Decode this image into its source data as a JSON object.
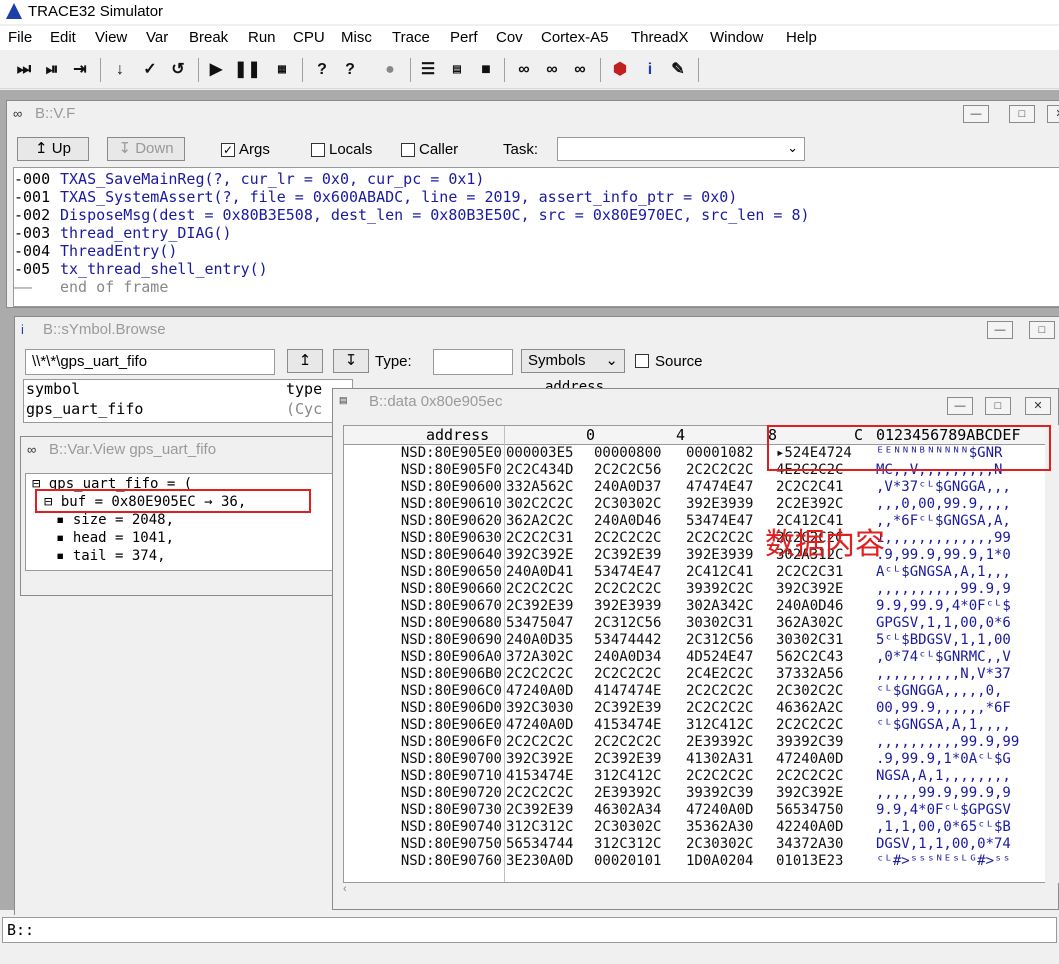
{
  "app": {
    "title": "TRACE32 Simulator"
  },
  "menu": [
    "File",
    "Edit",
    "View",
    "Var",
    "Break",
    "Run",
    "CPU",
    "Misc",
    "Trace",
    "Perf",
    "Cov",
    "Cortex-A5",
    "ThreadX",
    "Window",
    "Help"
  ],
  "frame_window": {
    "title": "B::V.F",
    "up_label": "Up",
    "down_label": "Down",
    "args_label": "Args",
    "locals_label": "Locals",
    "caller_label": "Caller",
    "task_label": "Task:",
    "task_value": "",
    "frames": [
      {
        "level": "-000",
        "text": "TXAS_SaveMainReg(?, cur_lr = 0x0, cur_pc = 0x1)"
      },
      {
        "level": "-001",
        "text": "TXAS_SystemAssert(?, file = 0x600ABADC, line = 2019, assert_info_ptr = 0x0)"
      },
      {
        "level": "-002",
        "text": "DisposeMsg(dest = 0x80B3E508, dest_len = 0x80B3E50C, src = 0x80E970EC, src_len = 8)"
      },
      {
        "level": "-003",
        "text": "thread_entry_DIAG()"
      },
      {
        "level": "-004",
        "text": "ThreadEntry()"
      },
      {
        "level": "-005",
        "text": "tx_thread_shell_entry()"
      },
      {
        "level": "——",
        "text": "end of frame"
      }
    ]
  },
  "symbol_window": {
    "title": "B::sYmbol.Browse",
    "filter": "\\\\*\\*\\gps_uart_fifo",
    "type_label": "Type:",
    "type_value": "",
    "mode_value": "Symbols",
    "source_label": "Source",
    "col_symbol": "symbol",
    "col_type": "type",
    "col_address": "address",
    "row_symbol": "gps_uart_fifo",
    "row_type": "(Cyc"
  },
  "var_window": {
    "title": "B::Var.View gps_uart_fifo",
    "lines": [
      "gps_uart_fifo = (",
      "buf = 0x80E905EC → 36,",
      "size = 2048,",
      "head = 1041,",
      "tail = 374,"
    ]
  },
  "data_window": {
    "title": "B::data 0x80e905ec",
    "col_address": "address",
    "col_0": "0",
    "col_4": "4",
    "col_8": "8",
    "col_c": "C",
    "col_ascii": "0123456789ABCDEF",
    "annotation": "数据内容",
    "rows": [
      {
        "a": "NSD:80E905E0",
        "w": [
          "000003E5",
          "00000800",
          "00001082",
          "▸524E4724"
        ],
        "s": "ᴱᴱᴺᴺᴺᴮᴺᴺᴺᴺᴺ$GNR"
      },
      {
        "a": "NSD:80E905F0",
        "w": [
          "2C2C434D",
          "2C2C2C56",
          "2C2C2C2C",
          "4E2C2C2C"
        ],
        "s": "MC,,V,,,,,,,,,N"
      },
      {
        "a": "NSD:80E90600",
        "w": [
          "332A562C",
          "240A0D37",
          "47474E47",
          "2C2C2C41"
        ],
        "s": ",V*37ᶜᴸ$GNGGA,,,"
      },
      {
        "a": "NSD:80E90610",
        "w": [
          "302C2C2C",
          "2C30302C",
          "392E3939",
          "2C2E392C"
        ],
        "s": ",,,0,00,99.9,,,,"
      },
      {
        "a": "NSD:80E90620",
        "w": [
          "362A2C2C",
          "240A0D46",
          "53474E47",
          "2C412C41"
        ],
        "s": ",,*6Fᶜᴸ$GNGSA,A,"
      },
      {
        "a": "NSD:80E90630",
        "w": [
          "2C2C2C31",
          "2C2C2C2C",
          "2C2C2C2C",
          "2C2C2C2C"
        ],
        "s": "1,,,,,,,,,,,,,99"
      },
      {
        "a": "NSD:80E90640",
        "w": [
          "392C392E",
          "2C392E39",
          "392E3939",
          "302A312C"
        ],
        "s": ".9,99.9,99.9,1*0"
      },
      {
        "a": "NSD:80E90650",
        "w": [
          "240A0D41",
          "53474E47",
          "2C412C41",
          "2C2C2C31"
        ],
        "s": "Aᶜᴸ$GNGSA,A,1,,,"
      },
      {
        "a": "NSD:80E90660",
        "w": [
          "2C2C2C2C",
          "2C2C2C2C",
          "39392C2C",
          "392C392E"
        ],
        "s": ",,,,,,,,,,99.9,9"
      },
      {
        "a": "NSD:80E90670",
        "w": [
          "2C392E39",
          "392E3939",
          "302A342C",
          "240A0D46"
        ],
        "s": "9.9,99.9,4*0Fᶜᴸ$"
      },
      {
        "a": "NSD:80E90680",
        "w": [
          "53475047",
          "2C312C56",
          "30302C31",
          "362A302C"
        ],
        "s": "GPGSV,1,1,00,0*6"
      },
      {
        "a": "NSD:80E90690",
        "w": [
          "240A0D35",
          "53474442",
          "2C312C56",
          "30302C31"
        ],
        "s": "5ᶜᴸ$BDGSV,1,1,00"
      },
      {
        "a": "NSD:80E906A0",
        "w": [
          "372A302C",
          "240A0D34",
          "4D524E47",
          "562C2C43"
        ],
        "s": ",0*74ᶜᴸ$GNRMC,,V"
      },
      {
        "a": "NSD:80E906B0",
        "w": [
          "2C2C2C2C",
          "2C2C2C2C",
          "2C4E2C2C",
          "37332A56"
        ],
        "s": ",,,,,,,,,,N,V*37"
      },
      {
        "a": "NSD:80E906C0",
        "w": [
          "47240A0D",
          "4147474E",
          "2C2C2C2C",
          "2C302C2C"
        ],
        "s": "ᶜᴸ$GNGGA,,,,,0,"
      },
      {
        "a": "NSD:80E906D0",
        "w": [
          "392C3030",
          "2C392E39",
          "2C2C2C2C",
          "46362A2C"
        ],
        "s": "00,99.9,,,,,,*6F"
      },
      {
        "a": "NSD:80E906E0",
        "w": [
          "47240A0D",
          "4153474E",
          "312C412C",
          "2C2C2C2C"
        ],
        "s": "ᶜᴸ$GNGSA,A,1,,,,"
      },
      {
        "a": "NSD:80E906F0",
        "w": [
          "2C2C2C2C",
          "2C2C2C2C",
          "2E39392C",
          "39392C39"
        ],
        "s": ",,,,,,,,,,99.9,99"
      },
      {
        "a": "NSD:80E90700",
        "w": [
          "392C392E",
          "2C392E39",
          "41302A31",
          "47240A0D"
        ],
        "s": ".9,99.9,1*0Aᶜᴸ$G"
      },
      {
        "a": "NSD:80E90710",
        "w": [
          "4153474E",
          "312C412C",
          "2C2C2C2C",
          "2C2C2C2C"
        ],
        "s": "NGSA,A,1,,,,,,,,"
      },
      {
        "a": "NSD:80E90720",
        "w": [
          "2C2C2C2C",
          "2E39392C",
          "39392C39",
          "392C392E"
        ],
        "s": ",,,,,99.9,99.9,9"
      },
      {
        "a": "NSD:80E90730",
        "w": [
          "2C392E39",
          "46302A34",
          "47240A0D",
          "56534750"
        ],
        "s": "9.9,4*0Fᶜᴸ$GPGSV"
      },
      {
        "a": "NSD:80E90740",
        "w": [
          "312C312C",
          "2C30302C",
          "35362A30",
          "42240A0D"
        ],
        "s": ",1,1,00,0*65ᶜᴸ$B"
      },
      {
        "a": "NSD:80E90750",
        "w": [
          "56534744",
          "312C312C",
          "2C30302C",
          "34372A30"
        ],
        "s": "DGSV,1,1,00,0*74"
      },
      {
        "a": "NSD:80E90760",
        "w": [
          "3E230A0D",
          "00020101",
          "1D0A0204",
          "01013E23"
        ],
        "s": "ᶜᴸ#>ˢˢˢᴺᴱˢᴸᴳ#>ˢˢ"
      }
    ]
  },
  "command_line": {
    "prompt": "B::",
    "value": ""
  },
  "colors": {
    "annotation": "#e02020",
    "symbol_blue": "#1a1aa0"
  }
}
